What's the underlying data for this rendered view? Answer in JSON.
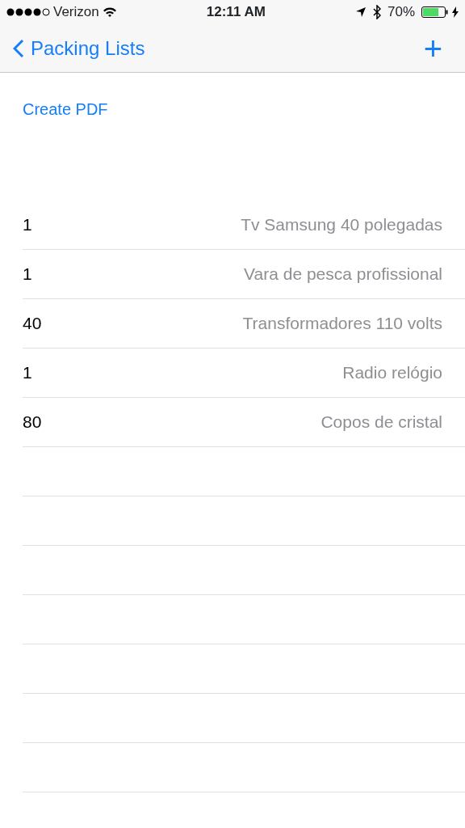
{
  "status_bar": {
    "carrier": "Verizon",
    "time": "12:11 AM",
    "battery": "70%"
  },
  "nav": {
    "back": "Packing Lists",
    "add": "+"
  },
  "action": "Create PDF",
  "items": [
    {
      "quantity": "1",
      "name": "Tv Samsung 40 polegadas"
    },
    {
      "quantity": "1",
      "name": "Vara de pesca profissional"
    },
    {
      "quantity": "40",
      "name": "Transformadores 110 volts"
    },
    {
      "quantity": "1",
      "name": "Radio relógio"
    },
    {
      "quantity": "80",
      "name": "Copos de cristal"
    }
  ]
}
